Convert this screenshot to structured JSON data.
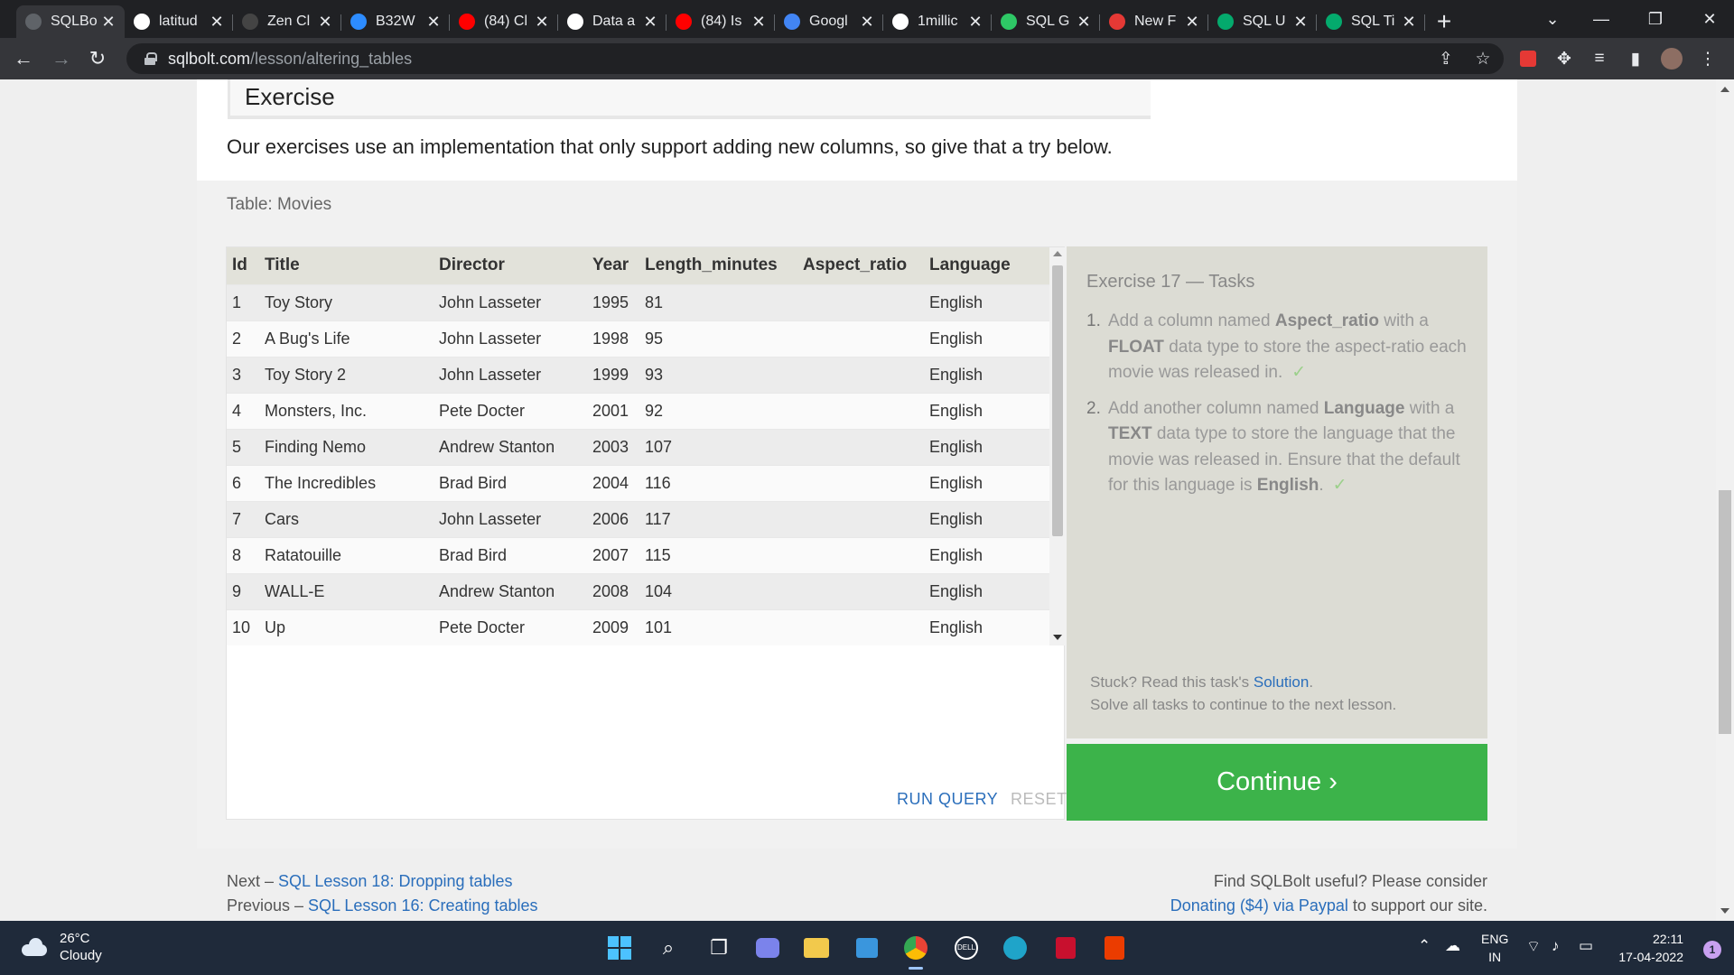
{
  "browser": {
    "tabs": [
      {
        "label": "SQLBo",
        "icon": "sqlbolt-icon",
        "color": "#5f6368",
        "active": true
      },
      {
        "label": "latitud",
        "icon": "google-icon",
        "color": "#ffffff"
      },
      {
        "label": "Zen Cl",
        "icon": "zen-icon",
        "color": "#444444"
      },
      {
        "label": "B32W",
        "icon": "zoom-icon",
        "color": "#2d8cff"
      },
      {
        "label": "(84) Cl",
        "icon": "youtube-icon",
        "color": "#ff0000"
      },
      {
        "label": "Data a",
        "icon": "google-icon",
        "color": "#ffffff"
      },
      {
        "label": "(84) Is",
        "icon": "youtube-icon",
        "color": "#ff0000"
      },
      {
        "label": "Googl",
        "icon": "translate-icon",
        "color": "#4285f4"
      },
      {
        "label": "1millic",
        "icon": "google-icon",
        "color": "#ffffff"
      },
      {
        "label": "SQL G",
        "icon": "hackerrank-icon",
        "color": "#2ec866"
      },
      {
        "label": "New F",
        "icon": "pdf-icon",
        "color": "#e53935"
      },
      {
        "label": "SQL U",
        "icon": "w3schools-icon",
        "color": "#04aa6d"
      },
      {
        "label": "SQL Ti",
        "icon": "w3schools-icon",
        "color": "#04aa6d"
      }
    ],
    "url_host": "sqlbolt.com",
    "url_path": "/lesson/altering_tables"
  },
  "page": {
    "exercise_heading": "Exercise",
    "exercise_intro": "Our exercises use an implementation that only support adding new columns, so give that a try below.",
    "table_caption": "Table: Movies",
    "table": {
      "columns": [
        "Id",
        "Title",
        "Director",
        "Year",
        "Length_minutes",
        "Aspect_ratio",
        "Language"
      ],
      "rows": [
        [
          "1",
          "Toy Story",
          "John Lasseter",
          "1995",
          "81",
          "",
          "English"
        ],
        [
          "2",
          "A Bug's Life",
          "John Lasseter",
          "1998",
          "95",
          "",
          "English"
        ],
        [
          "3",
          "Toy Story 2",
          "John Lasseter",
          "1999",
          "93",
          "",
          "English"
        ],
        [
          "4",
          "Monsters, Inc.",
          "Pete Docter",
          "2001",
          "92",
          "",
          "English"
        ],
        [
          "5",
          "Finding Nemo",
          "Andrew Stanton",
          "2003",
          "107",
          "",
          "English"
        ],
        [
          "6",
          "The Incredibles",
          "Brad Bird",
          "2004",
          "116",
          "",
          "English"
        ],
        [
          "7",
          "Cars",
          "John Lasseter",
          "2006",
          "117",
          "",
          "English"
        ],
        [
          "8",
          "Ratatouille",
          "Brad Bird",
          "2007",
          "115",
          "",
          "English"
        ],
        [
          "9",
          "WALL-E",
          "Andrew Stanton",
          "2008",
          "104",
          "",
          "English"
        ],
        [
          "10",
          "Up",
          "Pete Docter",
          "2009",
          "101",
          "",
          "English"
        ]
      ]
    },
    "run_query_label": "RUN QUERY",
    "reset_label": "RESET",
    "tasks": {
      "title": "Exercise 17 — Tasks",
      "task1_num": "1.",
      "task1_a": "Add a column named ",
      "task1_b": "Aspect_ratio",
      "task1_c": " with a ",
      "task1_d": "FLOAT",
      "task1_e": " data type to store the aspect-ratio each movie was released in.",
      "task2_num": "2.",
      "task2_a": "Add another column named ",
      "task2_b": "Language",
      "task2_c": " with a ",
      "task2_d": "TEXT",
      "task2_e": " data type to store the language that the movie was released in. Ensure that the default for this language is ",
      "task2_f": "English",
      "task2_g": ".",
      "check": "✓",
      "stuck_prefix": "Stuck? Read this task's ",
      "solution_link": "Solution",
      "stuck_suffix": ".",
      "solve_all": "Solve all tasks to continue to the next lesson."
    },
    "continue_label": "Continue ›",
    "footer": {
      "next_prefix": "Next – ",
      "next_link": "SQL Lesson 18: Dropping tables",
      "prev_prefix": "Previous – ",
      "prev_link": "SQL Lesson 16: Creating tables",
      "useful": "Find SQLBolt useful? Please consider",
      "donate_link": "Donating ($4) via Paypal",
      "support": " to support our site."
    }
  },
  "taskbar": {
    "temperature": "26°C",
    "weather": "Cloudy",
    "lang_top": "ENG",
    "lang_bottom": "IN",
    "time": "22:11",
    "date": "17-04-2022",
    "notifications": "1"
  }
}
